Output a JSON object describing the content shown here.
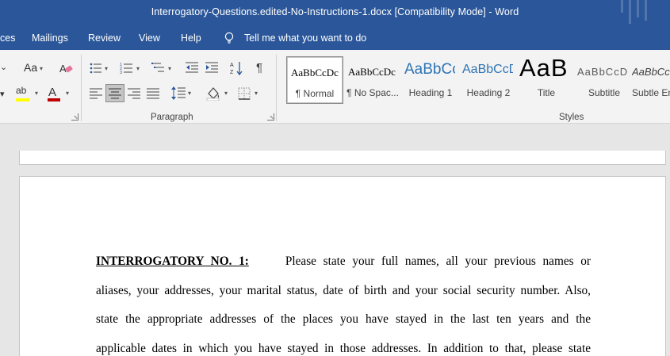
{
  "window": {
    "title": "Interrogatory-Questions.edited-No-Instructions-1.docx [Compatibility Mode]  -  Word"
  },
  "menu": {
    "items": [
      "ces",
      "Mailings",
      "Review",
      "View",
      "Help"
    ],
    "tell_me": "Tell me what you want to do"
  },
  "ribbon": {
    "font_group": {
      "change_case": "Aa",
      "highlight": "ab",
      "font_color": "A"
    },
    "paragraph_group": {
      "label": "Paragraph",
      "show_marks": "¶"
    },
    "styles_group": {
      "label": "Styles",
      "tiles": [
        {
          "sample": "AaBbCcDc",
          "name": "¶ Normal",
          "selected": true
        },
        {
          "sample": "AaBbCcDc",
          "name": "¶ No Spac..."
        },
        {
          "sample": "AaBbCc",
          "name": "Heading 1"
        },
        {
          "sample": "AaBbCcD",
          "name": "Heading 2"
        },
        {
          "sample": "AaB",
          "name": "Title"
        },
        {
          "sample": "AaBbCcD",
          "name": "Subtitle"
        },
        {
          "sample": "AaBbCcD",
          "name": "Subtle Em..."
        }
      ]
    }
  },
  "colors": {
    "title_bar": "#2b579a",
    "highlight_yellow": "#ffff00",
    "font_color_red": "#c00000",
    "ribbon_bg": "#f3f3f3"
  },
  "document": {
    "heading": "INTERROGATORY NO. 1:",
    "lines": [
      "Please state your full names, all your previous names or",
      "aliases, your addresses, your marital status, date of birth and your social security number. Also,",
      "state the appropriate addresses of the places you have stayed in the last ten years and the",
      "applicable dates in which you have stayed in those addresses. In addition to that, please state"
    ]
  }
}
